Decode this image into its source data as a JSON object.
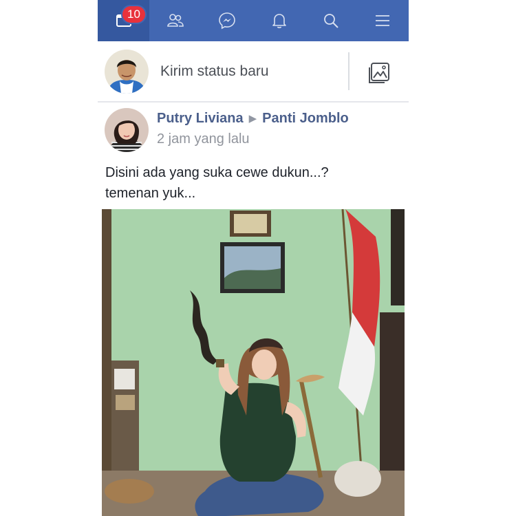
{
  "nav": {
    "notifications_badge": "10"
  },
  "composer": {
    "placeholder": "Kirim status baru"
  },
  "post": {
    "author": "Putry Liviana",
    "group": "Panti Jomblo",
    "time": "2 jam yang lalu",
    "text_line1": "Disini ada yang suka cewe dukun...?",
    "text_line2": "temenan yuk..."
  },
  "colors": {
    "nav_bg": "#4267b2",
    "badge": "#e8323c",
    "wall": "#a9d3ab"
  },
  "icons": [
    "news-feed-icon",
    "friends-icon",
    "messenger-icon",
    "bell-icon",
    "search-icon",
    "menu-icon",
    "photo-icon"
  ]
}
